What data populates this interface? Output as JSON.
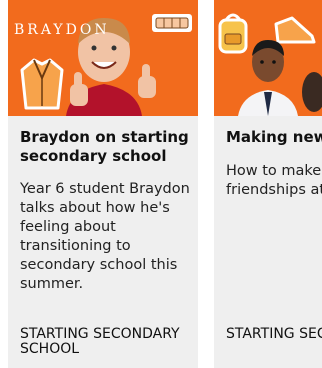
{
  "cards": [
    {
      "brand": "BRAYDON",
      "title": "Braydon on starting secondary school",
      "description": "Year 6 student Braydon talks about how he's feeling about transitioning to secondary school this summer.",
      "tag": "STARTING SECONDARY SCHOOL",
      "thumb_bg": "#f26b1d"
    },
    {
      "title": "Making new fr",
      "description": "How to make l friendships at y school.",
      "tag": "STARTING SECONDARY S",
      "thumb_bg": "#f26b1d"
    }
  ],
  "icons": [
    "blazer-icon",
    "bag-icon",
    "tie-icon",
    "pencil-case-icon",
    "backpack-icon",
    "shoe-icon"
  ],
  "colors": {
    "card_bg": "#efefef",
    "accent": "#f26b1d",
    "text": "#111111"
  }
}
